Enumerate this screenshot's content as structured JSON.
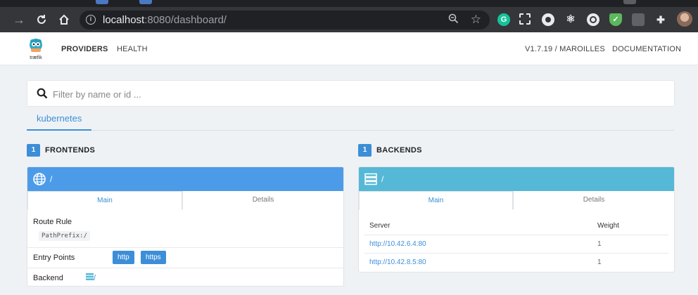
{
  "browser": {
    "url_host": "localhost",
    "url_rest": ":8080/dashboard/"
  },
  "app": {
    "logo_text": "træfik",
    "nav": {
      "providers": "PROVIDERS",
      "health": "HEALTH"
    },
    "version": "V1.7.19 / MAROILLES",
    "documentation": "DOCUMENTATION"
  },
  "search": {
    "placeholder": "Filter by name or id ..."
  },
  "provider_tabs": [
    {
      "label": "kubernetes"
    }
  ],
  "frontends": {
    "count": "1",
    "heading": "FRONTENDS",
    "card": {
      "title": "/",
      "tabs": {
        "main": "Main",
        "details": "Details"
      },
      "route_rule_label": "Route Rule",
      "route_rule_value": "PathPrefix:/",
      "entry_points_label": "Entry Points",
      "entry_points": [
        "http",
        "https"
      ],
      "backend_label": "Backend",
      "backend_value": "/"
    }
  },
  "backends": {
    "count": "1",
    "heading": "BACKENDS",
    "card": {
      "title": "/",
      "tabs": {
        "main": "Main",
        "details": "Details"
      },
      "columns": {
        "server": "Server",
        "weight": "Weight"
      },
      "servers": [
        {
          "url": "http://10.42.6.4:80",
          "weight": "1"
        },
        {
          "url": "http://10.42.8.5:80",
          "weight": "1"
        }
      ]
    }
  },
  "colors": {
    "accent": "#3d8ed8",
    "frontend_header": "#4c9be8",
    "backend_header": "#55b8d6"
  }
}
